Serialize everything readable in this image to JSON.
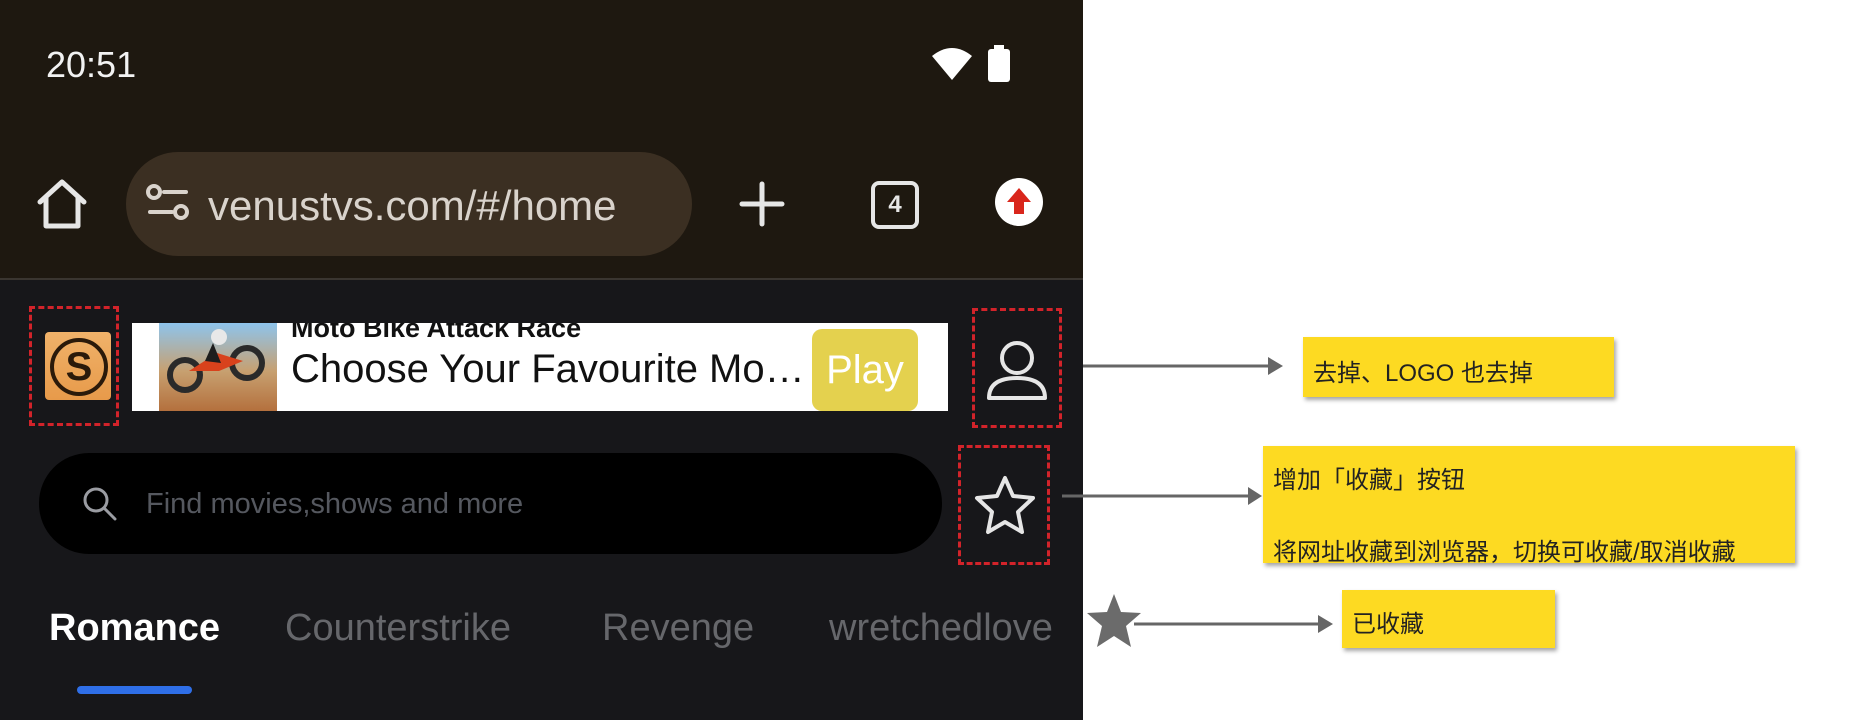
{
  "status_bar": {
    "time": "20:51",
    "icons": [
      "wifi-icon",
      "battery-icon"
    ]
  },
  "browser": {
    "url": "venustvs.com/#/home",
    "tab_count": "4",
    "icons": [
      "home-icon",
      "site-info-icon",
      "plus-icon",
      "tabs-icon",
      "update-icon"
    ]
  },
  "ad": {
    "title": "Moto Bike Attack Race",
    "text": "Choose Your Favourite Mo…",
    "button": "Play"
  },
  "search": {
    "placeholder": "Find movies,shows and more"
  },
  "categories": [
    "Romance",
    "Counterstrike",
    "Revenge",
    "wretchedlove"
  ],
  "annotations": {
    "remove": "去掉、LOGO 也去掉",
    "favorite_line1": "增加「收藏」按钮",
    "favorite_line2": "将网址收藏到浏览器，切换可收藏/取消收藏",
    "favorited": "已收藏"
  },
  "colors": {
    "background": "#17171a",
    "browser_bar": "#1e1810",
    "url_bar": "#3b2f22",
    "accent": "#2f6fe8",
    "highlight_box": "#d2232a",
    "note": "#fdda22",
    "play_button": "#e4d14e"
  }
}
